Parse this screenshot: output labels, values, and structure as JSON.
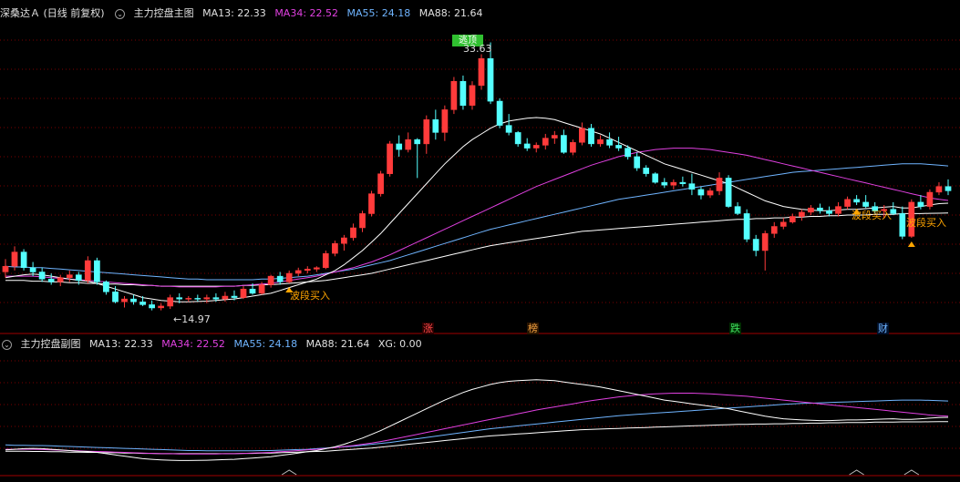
{
  "main_header": {
    "stock_name": "深桑达Ａ",
    "period": "(日线 前复权)",
    "indicator_name": "主力控盘主图",
    "indicators": [
      {
        "label": "MA13: 22.33",
        "color": "#e0e0e0"
      },
      {
        "label": "MA34: 22.52",
        "color": "#e040e0"
      },
      {
        "label": "MA55: 24.18",
        "color": "#6fb4ff"
      },
      {
        "label": "MA88: 21.64",
        "color": "#e0e0e0"
      }
    ]
  },
  "sub_header": {
    "indicator_name": "主力控盘副图",
    "indicators": [
      {
        "label": "MA13: 22.33",
        "color": "#e0e0e0"
      },
      {
        "label": "MA34: 22.52",
        "color": "#e040e0"
      },
      {
        "label": "MA55: 24.18",
        "color": "#6fb4ff"
      },
      {
        "label": "MA88: 21.64",
        "color": "#e0e0e0"
      },
      {
        "label": "XG: 0.00",
        "color": "#e0e0e0"
      }
    ]
  },
  "annotations": {
    "escape_label": "逃顶",
    "high_price": "33.63",
    "low_price": "←14.97",
    "buy_signal": "波段买入",
    "buy_signal_2": "波段买入",
    "buy_signal_3": "波段买入"
  },
  "event_markers": [
    {
      "label": "涨",
      "color": "#ff4a4a"
    },
    {
      "label": "榜",
      "color": "#f0a040"
    },
    {
      "label": "跌",
      "color": "#40e060"
    },
    {
      "label": "财",
      "color": "#6fb4ff"
    }
  ],
  "colors": {
    "up": "#ff3b3b",
    "down": "#54ffff",
    "grid": "#7a0000",
    "ma13": "#ffffff",
    "ma34": "#e040e0",
    "ma55": "#6fb4ff",
    "ma88": "#ffffff",
    "signal": "#ffa500",
    "escape_bg": "#30c030"
  },
  "chart_data": {
    "type": "candlestick",
    "candles": [
      [
        17.5,
        18.4,
        17.1,
        17.9
      ],
      [
        17.9,
        19.3,
        17.6,
        18.9
      ],
      [
        18.9,
        19.1,
        17.6,
        17.8
      ],
      [
        17.8,
        18.2,
        17.2,
        17.5
      ],
      [
        17.5,
        17.8,
        16.8,
        17.0
      ],
      [
        17.0,
        17.4,
        16.6,
        16.8
      ],
      [
        16.8,
        17.3,
        16.5,
        17.1
      ],
      [
        17.1,
        17.6,
        16.8,
        17.3
      ],
      [
        17.3,
        17.5,
        16.6,
        16.9
      ],
      [
        16.9,
        18.6,
        16.7,
        18.3
      ],
      [
        18.3,
        18.5,
        16.6,
        16.8
      ],
      [
        16.8,
        16.9,
        15.9,
        16.1
      ],
      [
        16.1,
        16.5,
        15.3,
        15.4
      ],
      [
        15.4,
        15.8,
        15.0,
        15.6
      ],
      [
        15.6,
        15.9,
        15.2,
        15.4
      ],
      [
        15.4,
        15.8,
        15.1,
        15.2
      ],
      [
        15.2,
        15.5,
        14.8,
        14.97
      ],
      [
        14.97,
        15.3,
        14.8,
        15.1
      ],
      [
        15.1,
        15.9,
        14.9,
        15.7
      ],
      [
        15.7,
        16.0,
        15.3,
        15.6
      ],
      [
        15.6,
        15.8,
        15.4,
        15.65
      ],
      [
        15.65,
        15.9,
        15.4,
        15.6
      ],
      [
        15.6,
        15.9,
        15.3,
        15.7
      ],
      [
        15.7,
        16.0,
        15.4,
        15.6
      ],
      [
        15.6,
        16.1,
        15.4,
        15.8
      ],
      [
        15.8,
        16.2,
        15.5,
        15.7
      ],
      [
        15.7,
        16.5,
        15.6,
        16.3
      ],
      [
        16.3,
        16.7,
        15.9,
        16.0
      ],
      [
        16.0,
        16.8,
        15.9,
        16.6
      ],
      [
        16.6,
        17.3,
        16.4,
        17.2
      ],
      [
        17.2,
        17.5,
        16.6,
        16.8
      ],
      [
        16.8,
        17.6,
        16.7,
        17.4
      ],
      [
        17.4,
        17.8,
        17.2,
        17.6
      ],
      [
        17.6,
        17.9,
        17.4,
        17.7
      ],
      [
        17.7,
        17.9,
        17.5,
        17.8
      ],
      [
        17.8,
        19.0,
        17.7,
        18.8
      ],
      [
        18.8,
        19.7,
        18.6,
        19.5
      ],
      [
        19.5,
        20.1,
        19.0,
        19.9
      ],
      [
        19.9,
        20.9,
        19.7,
        20.6
      ],
      [
        20.6,
        21.8,
        20.3,
        21.6
      ],
      [
        21.6,
        23.2,
        21.4,
        23.0
      ],
      [
        23.0,
        24.6,
        22.8,
        24.4
      ],
      [
        24.4,
        26.7,
        24.2,
        26.5
      ],
      [
        26.5,
        27.1,
        25.6,
        26.1
      ],
      [
        26.1,
        27.3,
        25.9,
        26.8
      ],
      [
        26.8,
        26.9,
        24.1,
        26.5
      ],
      [
        26.5,
        28.5,
        25.8,
        28.2
      ],
      [
        28.2,
        28.9,
        26.8,
        27.3
      ],
      [
        27.3,
        29.2,
        26.7,
        28.9
      ],
      [
        28.9,
        31.2,
        28.6,
        30.9
      ],
      [
        30.9,
        31.3,
        28.9,
        29.2
      ],
      [
        29.2,
        30.9,
        28.9,
        30.6
      ],
      [
        30.6,
        32.8,
        30.3,
        32.5
      ],
      [
        32.5,
        33.63,
        29.3,
        29.5
      ],
      [
        29.5,
        29.7,
        27.6,
        27.8
      ],
      [
        27.8,
        28.6,
        27.1,
        27.3
      ],
      [
        27.3,
        27.4,
        26.3,
        26.5
      ],
      [
        26.5,
        26.9,
        26.0,
        26.2
      ],
      [
        26.2,
        26.6,
        25.9,
        26.4
      ],
      [
        26.4,
        27.2,
        26.1,
        26.9
      ],
      [
        26.9,
        27.4,
        26.5,
        27.1
      ],
      [
        27.1,
        27.5,
        25.8,
        25.9
      ],
      [
        25.9,
        26.8,
        25.7,
        26.6
      ],
      [
        26.6,
        28.0,
        26.4,
        27.6
      ],
      [
        27.6,
        27.9,
        26.3,
        26.5
      ],
      [
        26.5,
        27.1,
        26.3,
        26.8
      ],
      [
        26.8,
        27.3,
        26.2,
        26.4
      ],
      [
        26.4,
        27.0,
        26.0,
        26.2
      ],
      [
        26.2,
        26.4,
        25.4,
        25.6
      ],
      [
        25.6,
        25.9,
        24.6,
        24.8
      ],
      [
        24.8,
        25.0,
        24.2,
        24.4
      ],
      [
        24.4,
        24.5,
        23.7,
        23.8
      ],
      [
        23.8,
        24.1,
        23.4,
        23.6
      ],
      [
        23.6,
        24.0,
        23.3,
        23.8
      ],
      [
        23.8,
        24.2,
        23.5,
        23.7
      ],
      [
        23.7,
        24.4,
        22.9,
        23.3
      ],
      [
        23.3,
        23.5,
        22.6,
        22.9
      ],
      [
        22.9,
        23.4,
        22.7,
        23.2
      ],
      [
        23.2,
        24.5,
        22.9,
        24.1
      ],
      [
        24.1,
        24.3,
        22.0,
        22.1
      ],
      [
        22.1,
        22.4,
        21.5,
        21.6
      ],
      [
        21.6,
        21.9,
        19.6,
        19.8
      ],
      [
        19.8,
        20.1,
        18.6,
        19.0
      ],
      [
        19.0,
        20.4,
        17.6,
        20.2
      ],
      [
        20.2,
        21.0,
        19.9,
        20.7
      ],
      [
        20.7,
        21.3,
        20.5,
        21.0
      ],
      [
        21.0,
        21.6,
        20.9,
        21.4
      ],
      [
        21.4,
        21.9,
        21.1,
        21.7
      ],
      [
        21.7,
        22.2,
        21.5,
        22.0
      ],
      [
        22.0,
        22.3,
        21.6,
        21.8
      ],
      [
        21.8,
        22.1,
        21.4,
        21.6
      ],
      [
        21.6,
        22.4,
        21.4,
        22.1
      ],
      [
        22.1,
        22.8,
        21.9,
        22.6
      ],
      [
        22.6,
        22.9,
        22.2,
        22.4
      ],
      [
        22.4,
        22.9,
        22.0,
        22.1
      ],
      [
        22.1,
        22.4,
        21.6,
        21.8
      ],
      [
        21.8,
        22.2,
        21.3,
        21.9
      ],
      [
        21.9,
        22.4,
        21.5,
        21.6
      ],
      [
        21.6,
        22.1,
        19.8,
        20.0
      ],
      [
        20.0,
        22.6,
        19.9,
        22.4
      ],
      [
        22.4,
        22.9,
        21.9,
        22.1
      ],
      [
        22.1,
        23.3,
        21.9,
        23.1
      ],
      [
        23.1,
        23.8,
        22.9,
        23.5
      ],
      [
        23.5,
        24.0,
        22.9,
        23.2
      ]
    ],
    "ma13": [
      17.1,
      17.2,
      17.3,
      17.35,
      17.3,
      17.2,
      17.1,
      17.0,
      16.9,
      16.85,
      16.7,
      16.5,
      16.3,
      16.1,
      15.9,
      15.7,
      15.6,
      15.5,
      15.45,
      15.4,
      15.4,
      15.42,
      15.45,
      15.5,
      15.55,
      15.6,
      15.7,
      15.8,
      15.9,
      16.0,
      16.2,
      16.4,
      16.6,
      16.8,
      17.0,
      17.3,
      17.6,
      18.0,
      18.5,
      19.0,
      19.6,
      20.2,
      20.9,
      21.6,
      22.3,
      23.0,
      23.7,
      24.4,
      25.1,
      25.7,
      26.3,
      26.8,
      27.2,
      27.6,
      27.9,
      28.1,
      28.2,
      28.3,
      28.35,
      28.3,
      28.2,
      28.0,
      27.8,
      27.6,
      27.4,
      27.2,
      26.9,
      26.6,
      26.3,
      26.0,
      25.7,
      25.4,
      25.1,
      24.9,
      24.7,
      24.5,
      24.3,
      24.1,
      23.9,
      23.7,
      23.4,
      23.1,
      22.8,
      22.5,
      22.3,
      22.1,
      22.0,
      21.9,
      21.85,
      21.8,
      21.8,
      21.85,
      21.9,
      21.9,
      21.95,
      22.0,
      22.05,
      22.1,
      22.0,
      22.0,
      22.1,
      22.2,
      22.3,
      22.33
    ],
    "ma34": [
      17.2,
      17.2,
      17.2,
      17.2,
      17.15,
      17.1,
      17.05,
      17.0,
      16.95,
      16.9,
      16.85,
      16.8,
      16.75,
      16.7,
      16.65,
      16.6,
      16.55,
      16.5,
      16.5,
      16.45,
      16.45,
      16.45,
      16.45,
      16.45,
      16.5,
      16.5,
      16.55,
      16.6,
      16.65,
      16.7,
      16.8,
      16.9,
      17.0,
      17.1,
      17.2,
      17.35,
      17.5,
      17.65,
      17.8,
      18.0,
      18.2,
      18.45,
      18.7,
      19.0,
      19.3,
      19.6,
      19.9,
      20.2,
      20.5,
      20.8,
      21.1,
      21.4,
      21.7,
      22.0,
      22.3,
      22.6,
      22.9,
      23.2,
      23.5,
      23.75,
      24.0,
      24.25,
      24.5,
      24.75,
      25.0,
      25.2,
      25.4,
      25.6,
      25.75,
      25.9,
      26.0,
      26.1,
      26.15,
      26.2,
      26.2,
      26.2,
      26.15,
      26.1,
      26.0,
      25.9,
      25.8,
      25.7,
      25.55,
      25.4,
      25.25,
      25.1,
      24.95,
      24.8,
      24.65,
      24.5,
      24.35,
      24.2,
      24.05,
      23.9,
      23.75,
      23.6,
      23.45,
      23.3,
      23.15,
      23.0,
      22.85,
      22.7,
      22.6,
      22.52
    ],
    "ma55": [
      17.9,
      17.85,
      17.85,
      17.8,
      17.8,
      17.75,
      17.7,
      17.65,
      17.6,
      17.55,
      17.5,
      17.45,
      17.4,
      17.35,
      17.3,
      17.25,
      17.2,
      17.15,
      17.1,
      17.05,
      17.0,
      17.0,
      16.95,
      16.95,
      16.95,
      16.95,
      16.95,
      16.95,
      17.0,
      17.0,
      17.05,
      17.1,
      17.15,
      17.2,
      17.3,
      17.4,
      17.5,
      17.6,
      17.7,
      17.85,
      18.0,
      18.15,
      18.3,
      18.5,
      18.7,
      18.9,
      19.1,
      19.3,
      19.5,
      19.7,
      19.9,
      20.1,
      20.3,
      20.5,
      20.65,
      20.8,
      20.95,
      21.1,
      21.25,
      21.4,
      21.55,
      21.7,
      21.85,
      22.0,
      22.15,
      22.3,
      22.45,
      22.6,
      22.7,
      22.8,
      22.9,
      23.0,
      23.1,
      23.2,
      23.3,
      23.4,
      23.5,
      23.6,
      23.7,
      23.8,
      23.9,
      24.0,
      24.1,
      24.2,
      24.3,
      24.4,
      24.5,
      24.55,
      24.6,
      24.65,
      24.7,
      24.75,
      24.8,
      24.85,
      24.9,
      24.95,
      25.0,
      25.05,
      25.1,
      25.1,
      25.1,
      25.05,
      25.0,
      24.95
    ],
    "ma88": [
      16.9,
      16.9,
      16.9,
      16.85,
      16.85,
      16.8,
      16.8,
      16.75,
      16.75,
      16.7,
      16.7,
      16.65,
      16.65,
      16.6,
      16.6,
      16.55,
      16.55,
      16.5,
      16.5,
      16.5,
      16.5,
      16.5,
      16.5,
      16.5,
      16.5,
      16.5,
      16.55,
      16.55,
      16.6,
      16.6,
      16.65,
      16.7,
      16.75,
      16.8,
      16.85,
      16.9,
      17.0,
      17.1,
      17.2,
      17.3,
      17.4,
      17.55,
      17.7,
      17.85,
      18.0,
      18.15,
      18.3,
      18.45,
      18.6,
      18.75,
      18.9,
      19.05,
      19.2,
      19.35,
      19.45,
      19.55,
      19.65,
      19.75,
      19.85,
      19.95,
      20.05,
      20.15,
      20.25,
      20.35,
      20.4,
      20.45,
      20.5,
      20.55,
      20.6,
      20.65,
      20.7,
      20.75,
      20.8,
      20.85,
      20.9,
      20.95,
      21.0,
      21.05,
      21.1,
      21.15,
      21.2,
      21.2,
      21.25,
      21.25,
      21.3,
      21.3,
      21.35,
      21.35,
      21.4,
      21.4,
      21.45,
      21.45,
      21.5,
      21.5,
      21.5,
      21.55,
      21.55,
      21.55,
      21.6,
      21.6,
      21.6,
      21.62,
      21.63,
      21.64
    ],
    "ylim": [
      14.2,
      35.2
    ],
    "signal_indices": [
      31,
      93,
      99
    ],
    "escape_index": 53,
    "low_index": 16
  }
}
